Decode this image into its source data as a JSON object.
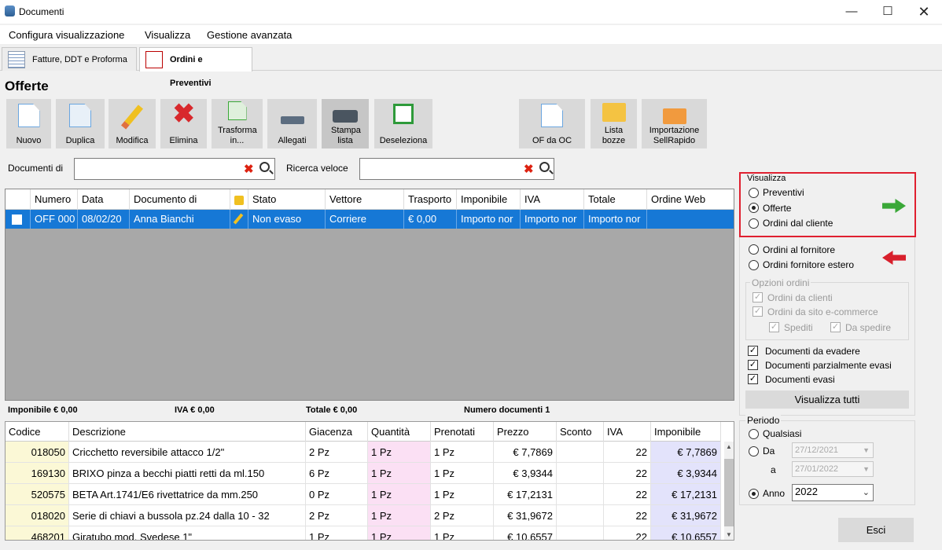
{
  "window": {
    "title": "Documenti"
  },
  "menu": [
    "Configura visualizzazione",
    "Visualizza",
    "Gestione avanzata"
  ],
  "tabs": [
    "Fatture, DDT e Proforma",
    "Ordini e Preventivi"
  ],
  "section_title": "Offerte",
  "toolbar": {
    "nuovo": "Nuovo",
    "duplica": "Duplica",
    "modifica": "Modifica",
    "elimina": "Elimina",
    "trasforma": "Trasforma in...",
    "allegati": "Allegati",
    "stampa": "Stampa lista",
    "deseleziona": "Deseleziona",
    "of_da_oc": "OF da OC",
    "lista_bozze": "Lista bozze",
    "importazione": "Importazione SellRapido"
  },
  "filters": {
    "documenti_di_label": "Documenti di",
    "ricerca_label": "Ricerca veloce",
    "documenti_di_value": "",
    "ricerca_value": ""
  },
  "grid": {
    "columns": [
      "",
      "Numero",
      "Data",
      "Documento di",
      "",
      "Stato",
      "Vettore",
      "Trasporto",
      "Imponibile",
      "IVA",
      "Totale",
      "Ordine Web"
    ],
    "row": {
      "numero": "OFF 000",
      "data": "08/02/20",
      "documento_di": "Anna Bianchi",
      "stato": "Non evaso",
      "vettore": "Corriere",
      "trasporto": "€ 0,00",
      "imponibile": "Importo nor",
      "iva": "Importo nor",
      "totale": "Importo nor",
      "ordine_web": ""
    }
  },
  "summary": {
    "imponibile": "Imponibile    € 0,00",
    "iva": "IVA    € 0,00",
    "totale": "Totale    € 0,00",
    "numero": "Numero documenti    1"
  },
  "details": {
    "columns": [
      "Codice",
      "Descrizione",
      "Giacenza",
      "Quantità",
      "Prenotati",
      "Prezzo",
      "Sconto",
      "IVA",
      "Imponibile"
    ],
    "rows": [
      {
        "codice": "018050",
        "descrizione": "Cricchetto reversibile attacco 1/2\"",
        "giacenza": "2 Pz",
        "quantita": "1 Pz",
        "prenotati": "1 Pz",
        "prezzo": "€ 7,7869",
        "sconto": "",
        "iva": "22",
        "imponibile": "€ 7,7869"
      },
      {
        "codice": "169130",
        "descrizione": "BRIXO pinza a becchi piatti retti da ml.150",
        "giacenza": "6 Pz",
        "quantita": "1 Pz",
        "prenotati": "1 Pz",
        "prezzo": "€ 3,9344",
        "sconto": "",
        "iva": "22",
        "imponibile": "€ 3,9344"
      },
      {
        "codice": "520575",
        "descrizione": "BETA Art.1741/E6 rivettatrice da mm.250",
        "giacenza": "0 Pz",
        "quantita": "1 Pz",
        "prenotati": "1 Pz",
        "prezzo": "€ 17,2131",
        "sconto": "",
        "iva": "22",
        "imponibile": "€ 17,2131"
      },
      {
        "codice": "018020",
        "descrizione": "Serie di chiavi a bussola  pz.24 dalla 10 - 32",
        "giacenza": "2 Pz",
        "quantita": "1 Pz",
        "prenotati": "2 Pz",
        "prezzo": "€ 31,9672",
        "sconto": "",
        "iva": "22",
        "imponibile": "€ 31,9672"
      },
      {
        "codice": "468201",
        "descrizione": "Giratubo mod. Svedese 1\"",
        "giacenza": "1 Pz",
        "quantita": "1 Pz",
        "prenotati": "1 Pz",
        "prezzo": "€ 10,6557",
        "sconto": "",
        "iva": "22",
        "imponibile": "€ 10,6557"
      }
    ]
  },
  "side": {
    "visualizza": "Visualizza",
    "preventivi": "Preventivi",
    "offerte": "Offerte",
    "ordini_cliente": "Ordini dal cliente",
    "ordini_fornitore": "Ordini al fornitore",
    "ordini_estero": "Ordini fornitore estero",
    "opzioni_ordini": "Opzioni ordini",
    "ordini_da_clienti": "Ordini da clienti",
    "ordini_ecommerce": "Ordini da sito e-commerce",
    "spediti": "Spediti",
    "da_spedire": "Da spedire",
    "doc_evadere": "Documenti da evadere",
    "doc_parziali": "Documenti parzialmente evasi",
    "doc_evasi": "Documenti evasi",
    "visualizza_tutti": "Visualizza tutti",
    "periodo": "Periodo",
    "qualsiasi": "Qualsiasi",
    "da": "Da",
    "a": "a",
    "anno": "Anno",
    "da_date": "27/12/2021",
    "a_date": "27/01/2022",
    "anno_value": "2022",
    "esci": "Esci"
  },
  "colors": {
    "selection": "#1678d6",
    "accent_red": "#e02030",
    "arrow_green": "#3aa838",
    "arrow_red": "#d8202c"
  }
}
